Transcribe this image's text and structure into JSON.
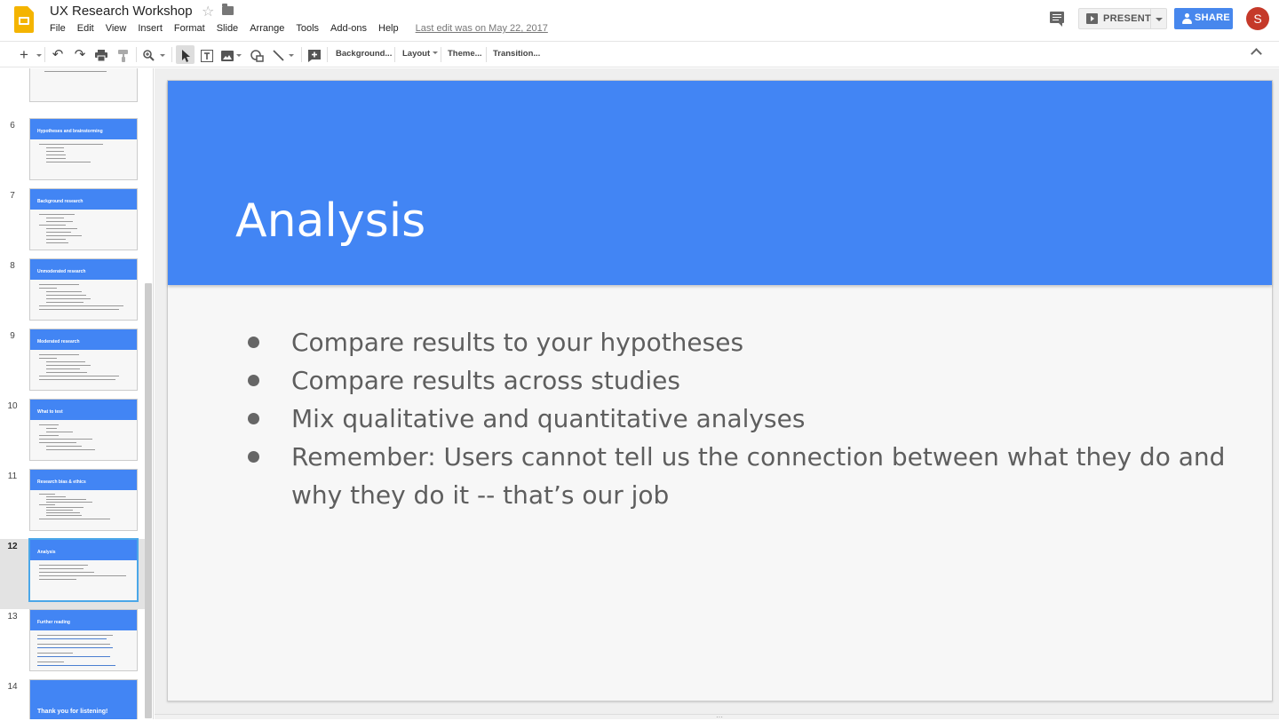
{
  "header": {
    "doc_title": "UX Research Workshop",
    "menus": [
      "File",
      "Edit",
      "View",
      "Insert",
      "Format",
      "Slide",
      "Arrange",
      "Tools",
      "Add-ons",
      "Help"
    ],
    "last_edit": "Last edit was on May 22, 2017",
    "present_label": "PRESENT",
    "share_label": "SHARE",
    "avatar_initial": "S",
    "accent_color": "#4285f4",
    "share_color": "#4787ed",
    "avatar_color": "#c53929"
  },
  "toolbar": {
    "background_label": "Background...",
    "layout_label": "Layout",
    "theme_label": "Theme...",
    "transition_label": "Transition...",
    "icons": [
      "new-slide-icon",
      "undo-icon",
      "redo-icon",
      "print-icon",
      "paint-format-icon",
      "zoom-icon",
      "select-icon",
      "text-box-icon",
      "image-icon",
      "shape-icon",
      "line-icon",
      "comment-add-icon",
      "collapse-icon"
    ]
  },
  "filmstrip": {
    "slides": [
      {
        "number": "6",
        "title": "Hypotheses and brainstorming"
      },
      {
        "number": "7",
        "title": "Background research"
      },
      {
        "number": "8",
        "title": "Unmoderated research"
      },
      {
        "number": "9",
        "title": "Moderated research"
      },
      {
        "number": "10",
        "title": "What to test"
      },
      {
        "number": "11",
        "title": "Research bias & ethics"
      },
      {
        "number": "12",
        "title": "Analysis"
      },
      {
        "number": "13",
        "title": "Further reading"
      },
      {
        "number": "14",
        "title": "Thank you for listening!"
      }
    ],
    "current_slide": "12"
  },
  "slide": {
    "title": "Analysis",
    "bullets": [
      "Compare results to your hypotheses",
      "Compare results across studies",
      "Mix qualitative and quantitative analyses",
      "Remember: Users cannot tell us the connection between what they do and why they do it -- that’s our job"
    ]
  }
}
